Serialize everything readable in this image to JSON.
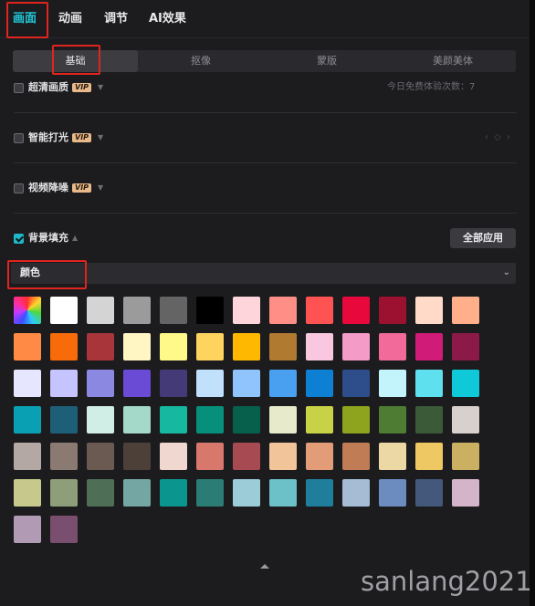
{
  "top_tabs": [
    {
      "label": "画面",
      "active": true
    },
    {
      "label": "动画",
      "active": false
    },
    {
      "label": "调节",
      "active": false
    },
    {
      "label": "AI效果",
      "active": false
    }
  ],
  "sub_tabs": [
    {
      "label": "基础",
      "active": true
    },
    {
      "label": "抠像",
      "active": false
    },
    {
      "label": "蒙版",
      "active": false
    },
    {
      "label": "美颜美体",
      "active": false
    }
  ],
  "options": {
    "hd": {
      "label": "超清画质",
      "badge": "VIP",
      "checked": false,
      "hint": "今日免费体验次数：7"
    },
    "smart_light": {
      "label": "智能打光",
      "badge": "VIP",
      "checked": false
    },
    "denoise": {
      "label": "视频降噪",
      "badge": "VIP",
      "checked": false
    },
    "bg_fill": {
      "label": "背景填充",
      "checked": true,
      "apply_all_label": "全部应用"
    }
  },
  "fill_type": {
    "value": "颜色"
  },
  "swatches": [
    "rainbow",
    "#ffffff",
    "#d4d4d4",
    "#9b9b9b",
    "#646464",
    "#000000",
    "#ffd5dc",
    "#ff8f86",
    "#ff5252",
    "#e8083c",
    "#9c1030",
    "#ffdac8",
    "#ffb08a",
    "#ff8a45",
    "#f76b0a",
    "#a8353a",
    "#fff6c4",
    "#fff98a",
    "#ffd45e",
    "#ffb802",
    "#b07a30",
    "#f9c8e0",
    "#f59bc8",
    "#f16a9a",
    "#d01c78",
    "#8c1a48",
    "#e6e6ff",
    "#c6c4ff",
    "#8a88e0",
    "#6a4bd6",
    "#443a78",
    "#c0e0fc",
    "#8fc4fc",
    "#4aa0f0",
    "#0d80d4",
    "#2d4e8a",
    "#c3f4fc",
    "#5ee0ee",
    "#0fc8d8",
    "#0aa0b4",
    "#1e5f78",
    "#d0eee6",
    "#a4d8c8",
    "#16b8a0",
    "#068f7a",
    "#07604c",
    "#e8eacc",
    "#c8d246",
    "#8ea41e",
    "#4e7c32",
    "#3a5a38",
    "#d8d0cc",
    "#b4a8a4",
    "#8a7a72",
    "#6a5a52",
    "#4c4038",
    "#f0d8d0",
    "#d8786c",
    "#a84a52",
    "#f2c49a",
    "#e29c78",
    "#c07c54",
    "#ecd8a4",
    "#eec862",
    "#cab060",
    "#c6c88c",
    "#8e9e78",
    "#4e6e56",
    "#74a6a4",
    "#0a968e",
    "#2a7c74",
    "#9cccd8",
    "#6cc0c8",
    "#1e7e9c",
    "#a6bcd4",
    "#6c8cc0",
    "#44587c",
    "#d4b4c8",
    "#b09ab4",
    "#7a4e6e"
  ],
  "watermark": "sanlang2021"
}
